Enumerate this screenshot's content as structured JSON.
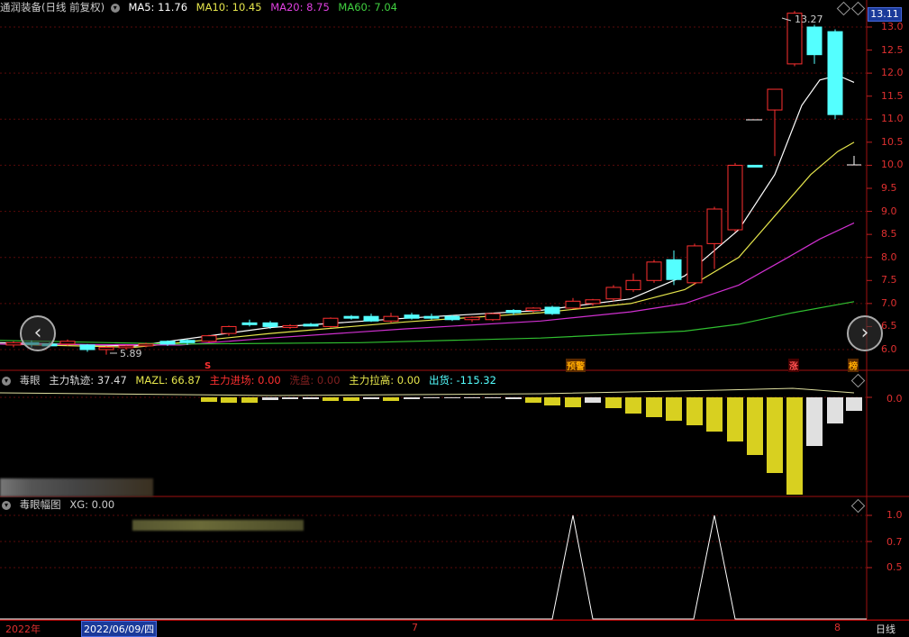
{
  "header": {
    "title": "通润装备(日线 前复权)",
    "ma5": "MA5: 11.76",
    "ma10": "MA10: 10.45",
    "ma20": "MA20: 8.75",
    "ma60": "MA60: 7.04",
    "current_price": "13.11"
  },
  "main_chart": {
    "high_label": "13.27",
    "low_label": "5.89",
    "y_ticks": [
      "13.0",
      "12.5",
      "12.0",
      "11.5",
      "11.0",
      "10.5",
      "10.0",
      "9.5",
      "9.0",
      "8.5",
      "8.0",
      "7.5",
      "7.0",
      "6.5",
      "6.0"
    ],
    "signals": {
      "s1": "S",
      "s2": "预警",
      "s3": "涨",
      "s4": "榜"
    },
    "colors": {
      "up": "#ff3030",
      "down": "#54ffff",
      "ma5": "#ffffff",
      "ma10": "#e6e64c",
      "ma20": "#d030d0",
      "ma60": "#30c030"
    }
  },
  "indicator1": {
    "name": "毒眼",
    "zhuli_guiji": "主力轨迹: 37.47",
    "mazl": "MAZL: 66.87",
    "zhuli_jinchang": "主力进场: 0.00",
    "xiqian": "洗盘: 0.00",
    "zhuli_lagao": "主力拉高: 0.00",
    "chuhuo": "出货: -115.32",
    "zero_tick": "0.0"
  },
  "indicator2": {
    "name": "毒眼幅图",
    "xg": "XG: 0.00",
    "y_ticks": [
      "1.0",
      "0.7",
      "0.5"
    ]
  },
  "date_bar": {
    "year": "2022年",
    "selected_date": "2022/06/09/四",
    "month7": "7",
    "month8": "8",
    "period": "日线"
  },
  "nav": {
    "left": "‹",
    "right": "›"
  }
}
